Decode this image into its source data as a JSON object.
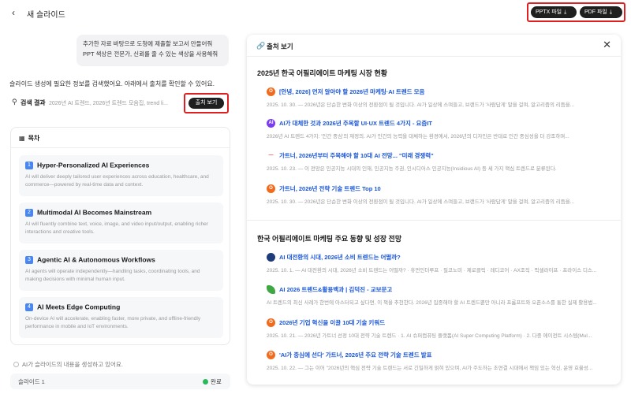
{
  "header": {
    "title": "새 슬라이드",
    "export_pptx": "PPTX 파일",
    "export_pdf": "PDF 파일"
  },
  "chat": {
    "user_message_line1": "추가한 자료 바탕으로 도청에 제출할 보고서 만들어줘",
    "user_message_line2": "PPT 색상은 전문가, 신뢰를 줄 수 있는 색상을 사용해줘",
    "info": "슬라이드 생성에 필요한 정보를 검색했어요. 아래에서 출처를 확인할 수 있어요.",
    "search_label": "검색 결과",
    "search_summary": "2026년 AI 트렌드, 2026년 트렌드 모음집, trend li...",
    "source_button": "출처 보기"
  },
  "toc": {
    "heading": "목차",
    "items": [
      {
        "num": "1",
        "title": "Hyper-Personalized AI Experiences",
        "desc": "AI will deliver deeply tailored user experiences across education, healthcare, and commerce—powered by real-time data and context."
      },
      {
        "num": "2",
        "title": "Multimodal AI Becomes Mainstream",
        "desc": "AI will fluently combine text, voice, image, and video input/output, enabling richer interactions and creative tools."
      },
      {
        "num": "3",
        "title": "Agentic AI & Autonomous Workflows",
        "desc": "AI agents will operate independently—handling tasks, coordinating tools, and making decisions with minimal human input."
      },
      {
        "num": "4",
        "title": "AI Meets Edge Computing",
        "desc": "On-device AI will accelerate, enabling faster, more private, and offline-friendly performance in mobile and IoT environments."
      }
    ]
  },
  "generation": {
    "status": "AI가 슬라이드의 내용을 생성하고 있어요.",
    "slide_label": "슬라이드 1",
    "slide_status": "완료"
  },
  "sources": {
    "title": "출처 보기",
    "sections": [
      {
        "title": "2025년 한국 어필리에이트 마케팅 시장 현황",
        "items": [
          {
            "icon": "orange-o",
            "color": "#f26b1d",
            "title": "[안녕, 2026] 먼저 알아야 할 2026년 마케팅·AI 트렌드 모음",
            "snippet": "2025. 10. 30. — 2026년은 단순한 변화 이상의 전환점이 될 것입니다. AI가 일상에 스며들고, 브랜드가 '사람답게' 말을 걸며, 알고리즘의 리듬을..."
          },
          {
            "icon": "purple-ai",
            "color": "#7a3cf0",
            "title": "AI가 대체한 것과 2026년 주목할 UI·UX 트렌드 4가지 - 요즘IT",
            "snippet": "2026년 AI 트렌드 4가지: '인간 중심'의 재정의. AI가 인간의 능력을 대체하는 환경에서, 2026년의 디자인은 반대로 인간 중심성을 더 강조하며..."
          },
          {
            "icon": "red-dash",
            "color": "#e23b3b",
            "title": "가트너, 2026년부터 주목해야 할 10대 AI 전망... \"미래 경쟁력\"",
            "snippet": "2025. 10. 23. — 이 전망은 인공지능 시대의 인재, 인공지능 주권, 인시디어스 인공지능(Insidious AI) 등 세 가지 핵심 트렌드로 분류된다."
          },
          {
            "icon": "orange-o",
            "color": "#f26b1d",
            "title": "가트너, 2026년 전략 기술 트렌드 Top 10",
            "snippet": "2025. 10. 30. — 2026년은 단순한 변화 이상의 전환점이 될 것입니다. AI가 일상에 스며들고, 브랜드가 '사람답게' 말을 걸며, 알고리즘의 리듬을..."
          }
        ]
      },
      {
        "title": "한국 어필리에이트 마케팅 주요 동향 및 성장 전망",
        "items": [
          {
            "icon": "navy-circle",
            "color": "#1f3c7a",
            "title": "AI 대전환의 시대, 2026년 소비 트렌드는 어떨까?",
            "snippet": "2025. 10. 1. — AI 대전환의 시대, 2026년 소비 트렌드는 어떨까? · 휴먼인더루프 · 필코노미 · 제로클릭 · 레디코어 · AX조직 · 픽셀라이프 · 프라이스 디스..."
          },
          {
            "icon": "green-leaf",
            "color": "#3fa843",
            "title": "AI 2026 트렌드&활용백과 | 김덕진 - 교보문고",
            "snippet": "AI 트렌드의 최신 사례가 한번에 아스터되고 싶다면, 이 책을 추천한다. 2026년 집중해야 할 AI 트렌드뿐만 아니라 프롬프트와 오픈소스를 통한 실제 활용법..."
          },
          {
            "icon": "orange-o",
            "color": "#f26b1d",
            "title": "2026년 기업 혁신을 이끌 10대 기술 키워드",
            "snippet": "2025. 10. 21. — 2026년 가트너 선정 10대 전략 기술 트렌드 · 1. AI 슈퍼컴퓨팅 플랫폼(AI Super Computing Platform) · 2. 다중 에이전트 시스템(Mul..."
          },
          {
            "icon": "orange-o",
            "color": "#f26b1d",
            "title": "'AI가 중심에 선다' 가트너, 2026년 주요 전략 기술 트렌드 발표",
            "snippet": "2025. 10. 22. — 그는 이어 \"2026년의 핵심 전략 기술 트렌드는 서로 긴밀하게 얽혀 있으며, AI가 주도하는 초연결 시대에서 책임 있는 혁신, 운영 효율성..."
          }
        ]
      }
    ]
  }
}
